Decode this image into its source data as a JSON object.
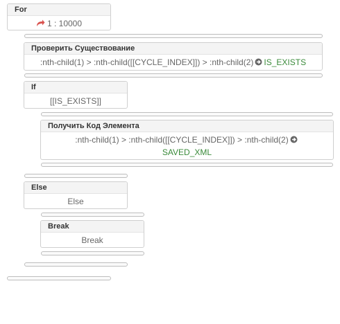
{
  "for_block": {
    "title": "For",
    "range": "1 : 10000",
    "icon": "redo-arrow-icon",
    "icon_color": "#d9534f"
  },
  "check_block": {
    "title": "Проверить Существование",
    "selector": ":nth-child(1) > :nth-child([[CYCLE_INDEX]]) > :nth-child(2)",
    "result_var": "IS_EXISTS",
    "icon": "arrow-circle-right-icon"
  },
  "if_block": {
    "title": "If",
    "condition": "[[IS_EXISTS]]"
  },
  "get_code_block": {
    "title": "Получить Код Элемента",
    "selector": ":nth-child(1) > :nth-child([[CYCLE_INDEX]]) > :nth-child(2)",
    "result_var": "SAVED_XML",
    "icon": "arrow-circle-right-icon"
  },
  "else_block": {
    "title": "Else",
    "label": "Else"
  },
  "break_block": {
    "title": "Break",
    "label": "Break"
  },
  "colors": {
    "variable_green": "#3a8a3a",
    "border": "#cfcfcf",
    "header_bg": "#f4f4f4"
  }
}
